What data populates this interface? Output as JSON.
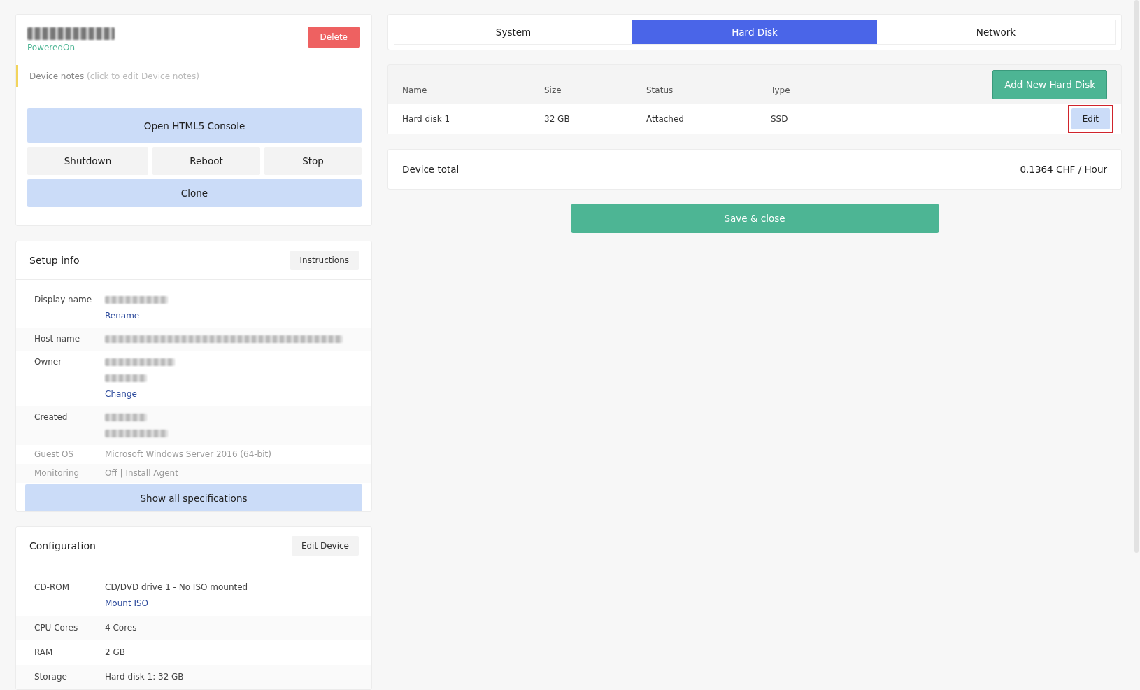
{
  "device": {
    "status": "PoweredOn",
    "delete_button": "Delete",
    "notes_label": "Device notes",
    "notes_hint": "(click to edit Device notes)",
    "buttons": [
      {
        "label": "Open HTML5 Console",
        "kind": "primary"
      },
      {
        "label": "Shutdown",
        "kind": "secondary"
      },
      {
        "label": "Reboot",
        "kind": "secondary"
      },
      {
        "label": "Stop",
        "kind": "secondary"
      },
      {
        "label": "Clone",
        "kind": "primary"
      }
    ]
  },
  "setup_info": {
    "title": "Setup info",
    "action": "Instructions",
    "rows": [
      {
        "label": "Display name",
        "link": "Rename"
      },
      {
        "label": "Host name"
      },
      {
        "label": "Owner",
        "link": "Change"
      },
      {
        "label": "Created"
      },
      {
        "label": "Guest OS",
        "value": "Microsoft Windows Server 2016 (64-bit)",
        "faded": true
      },
      {
        "label": "Monitoring",
        "value": "Off | Install Agent",
        "faded": true
      }
    ],
    "show_all_button": "Show all specifications"
  },
  "configuration": {
    "title": "Configuration",
    "action": "Edit Device",
    "rows": [
      {
        "label": "CD-ROM",
        "value": "CD/DVD drive 1 - No ISO mounted",
        "link": "Mount ISO"
      },
      {
        "label": "CPU Cores",
        "value": "4 Cores"
      },
      {
        "label": "RAM",
        "value": "2 GB"
      },
      {
        "label": "Storage",
        "value": "Hard disk 1: 32 GB"
      }
    ]
  },
  "tabs": [
    {
      "label": "System",
      "selected": false
    },
    {
      "label": "Hard Disk",
      "selected": true
    },
    {
      "label": "Network",
      "selected": false
    }
  ],
  "hard_disks": {
    "add_button": "Add New Hard Disk",
    "columns": [
      "Name",
      "Size",
      "Status",
      "Type"
    ],
    "rows": [
      {
        "cells": [
          "Hard disk 1",
          "32 GB",
          "Attached",
          "SSD"
        ],
        "action": "Edit",
        "highlighted": true
      }
    ]
  },
  "device_total": {
    "label": "Device total",
    "value": "0.1364 CHF / Hour"
  },
  "save_button": "Save & close"
}
